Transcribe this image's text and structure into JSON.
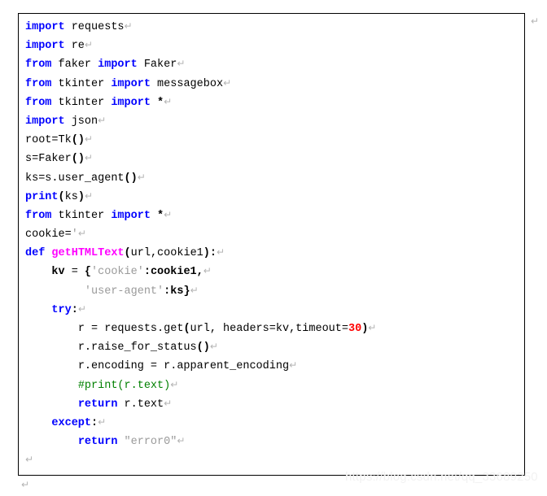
{
  "document": {
    "type": "python-code-listing",
    "language": "Python",
    "cr_glyph": "↵",
    "colors": {
      "keyword": "#0000ff",
      "function_name": "#ff00ff",
      "string": "#9a9a9a",
      "number": "#ff0000",
      "comment": "#008000",
      "plain": "#000000",
      "border": "#000000",
      "background": "#ffffff",
      "cr_mark": "#b4b4b4",
      "watermark": "#f2f2f2"
    }
  },
  "watermark": {
    "text": "https://blog.csdn.net/qq_33689250"
  },
  "code": {
    "lines": [
      {
        "id": 1,
        "indent": 0,
        "tokens": [
          {
            "t": "import",
            "k": "kw"
          },
          {
            "t": " requests",
            "k": "plain"
          }
        ],
        "cr": true
      },
      {
        "id": 2,
        "indent": 0,
        "tokens": [
          {
            "t": "import",
            "k": "kw"
          },
          {
            "t": " re",
            "k": "plain"
          }
        ],
        "cr": true
      },
      {
        "id": 3,
        "indent": 0,
        "tokens": [
          {
            "t": "from",
            "k": "kw"
          },
          {
            "t": " faker ",
            "k": "plain"
          },
          {
            "t": "import",
            "k": "kw"
          },
          {
            "t": " Faker",
            "k": "plain"
          }
        ],
        "cr": true
      },
      {
        "id": 4,
        "indent": 0,
        "tokens": [
          {
            "t": "from",
            "k": "kw"
          },
          {
            "t": " tkinter ",
            "k": "plain"
          },
          {
            "t": "import",
            "k": "kw"
          },
          {
            "t": " messagebox",
            "k": "plain"
          }
        ],
        "cr": true
      },
      {
        "id": 5,
        "indent": 0,
        "tokens": [
          {
            "t": "from",
            "k": "kw"
          },
          {
            "t": " tkinter ",
            "k": "plain"
          },
          {
            "t": "import",
            "k": "kw"
          },
          {
            "t": " ",
            "k": "plain"
          },
          {
            "t": "*",
            "k": "bold"
          }
        ],
        "cr": true
      },
      {
        "id": 6,
        "indent": 0,
        "tokens": [
          {
            "t": "import",
            "k": "kw"
          },
          {
            "t": " json",
            "k": "plain"
          }
        ],
        "cr": true
      },
      {
        "id": 7,
        "indent": 0,
        "tokens": [
          {
            "t": "root=Tk",
            "k": "plain"
          },
          {
            "t": "()",
            "k": "bold"
          }
        ],
        "cr": true
      },
      {
        "id": 8,
        "indent": 0,
        "tokens": [
          {
            "t": "s=Faker",
            "k": "plain"
          },
          {
            "t": "()",
            "k": "bold"
          }
        ],
        "cr": true
      },
      {
        "id": 9,
        "indent": 0,
        "tokens": [
          {
            "t": "ks=s.user_agent",
            "k": "plain"
          },
          {
            "t": "()",
            "k": "bold"
          }
        ],
        "cr": true
      },
      {
        "id": 10,
        "indent": 0,
        "tokens": [
          {
            "t": "print",
            "k": "kw"
          },
          {
            "t": "(",
            "k": "bold"
          },
          {
            "t": "ks",
            "k": "plain"
          },
          {
            "t": ")",
            "k": "bold"
          }
        ],
        "cr": true
      },
      {
        "id": 11,
        "indent": 0,
        "tokens": [
          {
            "t": "from",
            "k": "kw"
          },
          {
            "t": " tkinter ",
            "k": "plain"
          },
          {
            "t": "import",
            "k": "kw"
          },
          {
            "t": " ",
            "k": "plain"
          },
          {
            "t": "*",
            "k": "bold"
          }
        ],
        "cr": true
      },
      {
        "id": 12,
        "indent": 0,
        "tokens": [
          {
            "t": "cookie=",
            "k": "plain"
          },
          {
            "t": "'",
            "k": "str"
          }
        ],
        "cr": true
      },
      {
        "id": 13,
        "indent": 0,
        "tokens": [
          {
            "t": "def",
            "k": "kw"
          },
          {
            "t": " ",
            "k": "plain"
          },
          {
            "t": "getHTMLText",
            "k": "fn"
          },
          {
            "t": "(",
            "k": "bold"
          },
          {
            "t": "url,cookie1",
            "k": "plain"
          },
          {
            "t": "):",
            "k": "bold"
          }
        ],
        "cr": true
      },
      {
        "id": 14,
        "indent": 1,
        "tokens": [
          {
            "t": "kv",
            "k": "bold"
          },
          {
            "t": " = ",
            "k": "plain"
          },
          {
            "t": "{",
            "k": "bold"
          },
          {
            "t": "'cookie'",
            "k": "str"
          },
          {
            "t": ":",
            "k": "bold"
          },
          {
            "t": "cookie1",
            "k": "bold"
          },
          {
            "t": ",",
            "k": "bold"
          }
        ],
        "cr": true
      },
      {
        "id": 15,
        "indent": 2,
        "tokens": [
          {
            "t": " ",
            "k": "plain"
          },
          {
            "t": "'user-agent'",
            "k": "str"
          },
          {
            "t": ":",
            "k": "bold"
          },
          {
            "t": "ks}",
            "k": "bold"
          }
        ],
        "cr": true
      },
      {
        "id": 16,
        "indent": 1,
        "tokens": [
          {
            "t": "try",
            "k": "kw"
          },
          {
            "t": ":",
            "k": "bold"
          }
        ],
        "cr": true
      },
      {
        "id": 17,
        "indent": 2,
        "tokens": [
          {
            "t": "r = requests.get",
            "k": "plain"
          },
          {
            "t": "(",
            "k": "bold"
          },
          {
            "t": "url, headers=kv,timeout=",
            "k": "plain"
          },
          {
            "t": "30",
            "k": "num"
          },
          {
            "t": ")",
            "k": "bold"
          }
        ],
        "cr": true
      },
      {
        "id": 18,
        "indent": 2,
        "tokens": [
          {
            "t": "r.raise_for_status",
            "k": "plain"
          },
          {
            "t": "()",
            "k": "bold"
          }
        ],
        "cr": true
      },
      {
        "id": 19,
        "indent": 2,
        "tokens": [
          {
            "t": "r.encoding = r.apparent_encoding",
            "k": "plain"
          }
        ],
        "cr": true
      },
      {
        "id": 20,
        "indent": 2,
        "tokens": [
          {
            "t": "#print(r.text)",
            "k": "com"
          }
        ],
        "cr": true
      },
      {
        "id": 21,
        "indent": 2,
        "tokens": [
          {
            "t": "return",
            "k": "kw"
          },
          {
            "t": " r.text",
            "k": "plain"
          }
        ],
        "cr": true
      },
      {
        "id": 22,
        "indent": 1,
        "tokens": [
          {
            "t": "except",
            "k": "kw"
          },
          {
            "t": ":",
            "k": "bold"
          }
        ],
        "cr": true
      },
      {
        "id": 23,
        "indent": 2,
        "tokens": [
          {
            "t": "return",
            "k": "kw"
          },
          {
            "t": " ",
            "k": "plain"
          },
          {
            "t": "\"error0\"",
            "k": "str"
          }
        ],
        "cr": true
      },
      {
        "id": 24,
        "indent": 0,
        "tokens": [],
        "cr": true
      }
    ]
  },
  "marks": {
    "outside_top_right": "↵",
    "outside_bottom_left": "↵"
  }
}
